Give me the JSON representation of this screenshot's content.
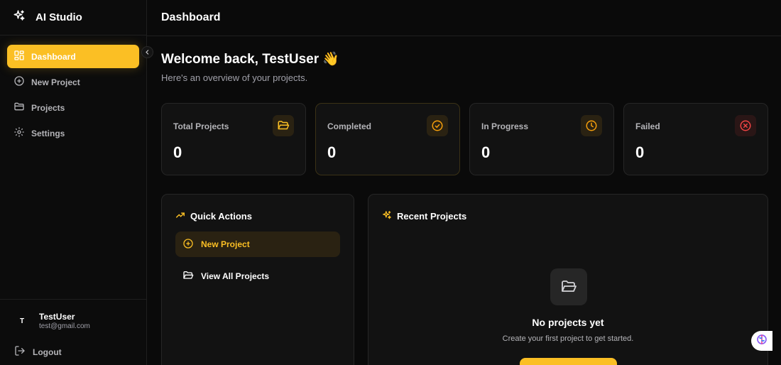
{
  "app": {
    "name": "AI Studio"
  },
  "sidebar": {
    "items": [
      {
        "label": "Dashboard",
        "icon": "layout-grid-icon",
        "active": true
      },
      {
        "label": "New Project",
        "icon": "plus-circle-icon"
      },
      {
        "label": "Projects",
        "icon": "folder-icon"
      },
      {
        "label": "Settings",
        "icon": "gear-icon"
      }
    ],
    "user": {
      "initial": "T",
      "name": "TestUser",
      "email": "test@gmail.com"
    },
    "logout_label": "Logout"
  },
  "header": {
    "title": "Dashboard"
  },
  "main": {
    "welcome": "Welcome back, TestUser 👋",
    "subtitle": "Here's an overview of your projects.",
    "stats": [
      {
        "label": "Total Projects",
        "value": "0",
        "icon": "folder-open-icon",
        "color": "#fbbf24"
      },
      {
        "label": "Completed",
        "value": "0",
        "icon": "check-circle-icon",
        "color": "#f59e0b"
      },
      {
        "label": "In Progress",
        "value": "0",
        "icon": "clock-icon",
        "color": "#f59e0b"
      },
      {
        "label": "Failed",
        "value": "0",
        "icon": "x-circle-icon",
        "color": "#ef4444"
      }
    ],
    "quick_actions": {
      "title": "Quick Actions",
      "items": [
        {
          "label": "New Project",
          "icon": "plus-circle-icon"
        },
        {
          "label": "View All Projects",
          "icon": "folder-open-icon"
        }
      ]
    },
    "recent_projects": {
      "title": "Recent Projects",
      "empty_title": "No projects yet",
      "empty_desc": "Create your first project to get started."
    }
  },
  "colors": {
    "accent": "#fbbf24",
    "background": "#0a0a0a",
    "card": "#121212",
    "danger": "#ef4444"
  }
}
